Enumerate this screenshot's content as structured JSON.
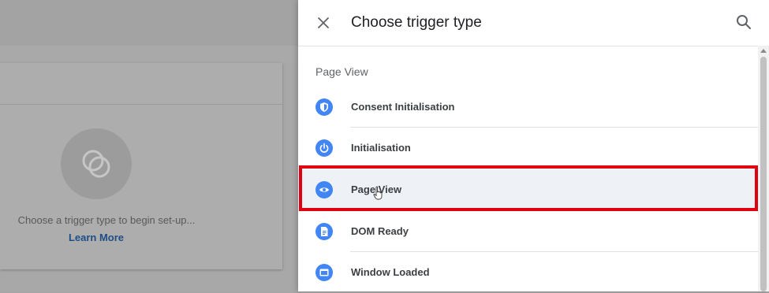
{
  "background": {
    "empty_state_text": "Choose a trigger type to begin set-up...",
    "learn_more": "Learn More"
  },
  "panel": {
    "title": "Choose trigger type",
    "section_heading": "Page View",
    "items": [
      {
        "label": "Consent Initialisation",
        "icon": "shield-icon"
      },
      {
        "label": "Initialisation",
        "icon": "power-icon"
      },
      {
        "label": "Page View",
        "icon": "eye-icon"
      },
      {
        "label": "DOM Ready",
        "icon": "document-icon"
      },
      {
        "label": "Window Loaded",
        "icon": "window-icon"
      }
    ],
    "selected_item": "Page View"
  },
  "colors": {
    "accent": "#4285f4",
    "highlight": "#e0000f",
    "link": "#1f4e86"
  }
}
